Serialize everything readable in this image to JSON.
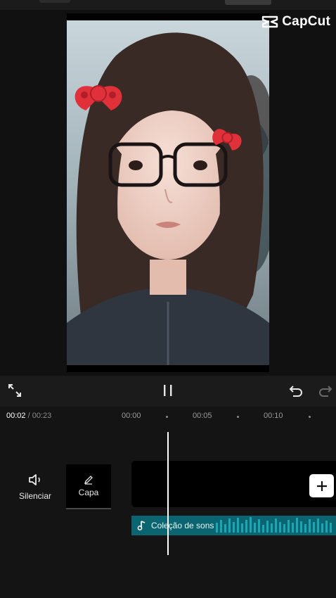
{
  "watermark": {
    "brand": "CapCut",
    "icon": "capcut-logo-icon"
  },
  "controls": {
    "fullscreen_icon": "fullscreen-icon",
    "play_pause_icon": "pause-icon",
    "undo_icon": "undo-icon",
    "redo_icon": "redo-icon"
  },
  "timecode": {
    "current": "00:02",
    "separator": " / ",
    "total": "00:23"
  },
  "ruler": {
    "ticks": [
      "00:00",
      "00:05",
      "00:10"
    ]
  },
  "tools": {
    "mute_label": "Silenciar",
    "mute_icon": "speaker-icon",
    "cover_label": "Capa",
    "cover_icon": "pencil-icon"
  },
  "tracks": {
    "add_icon": "plus-icon",
    "audio_label": "Coleção de sons",
    "audio_icon": "music-note-icon"
  },
  "colors": {
    "background": "#1b1b1b",
    "timeline_bg": "#141414",
    "audio_track": "#0b6570",
    "audio_wave": "#1aa6b4",
    "accent_white": "#ffffff"
  }
}
